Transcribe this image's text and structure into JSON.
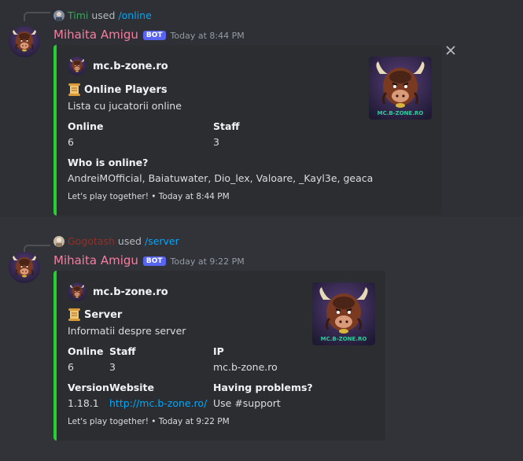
{
  "messages": [
    {
      "reply": {
        "user": "Timi",
        "user_color": "#3ba55c",
        "verb": "used",
        "command": "/online"
      },
      "author": {
        "name": "Mihaita Amigu",
        "badge": "BOT",
        "timestamp": "Today at 8:44 PM"
      },
      "embed": {
        "accent": "#23d132",
        "author_name": "mc.b-zone.ro",
        "title_emoji": "scroll-icon",
        "title": "Online Players",
        "description": "Lista cu jucatorii online",
        "fields": [
          {
            "name": "Online",
            "value": "6"
          },
          {
            "name": "Staff",
            "value": "3"
          },
          {
            "name": "Who is online?",
            "value": "AndreiMOfficial, Baiatuwater, Dio_lex, Valoare, _Kayl3e, geaca"
          }
        ],
        "footer": "Let's play together! • Today at 8:44 PM",
        "thumbnail_text": "MC.B-ZONE.RO"
      }
    },
    {
      "reply": {
        "user": "Gogotash",
        "user_color": "#992d22",
        "verb": "used",
        "command": "/server"
      },
      "author": {
        "name": "Mihaita Amigu",
        "badge": "BOT",
        "timestamp": "Today at 9:22 PM"
      },
      "embed": {
        "accent": "#23d132",
        "author_name": "mc.b-zone.ro",
        "title_emoji": "scroll-icon",
        "title": "Server",
        "description": "Informatii despre server",
        "fields": [
          {
            "name": "Online",
            "value": "6"
          },
          {
            "name": "Staff",
            "value": "3"
          },
          {
            "name": "IP",
            "value": "mc.b-zone.ro"
          },
          {
            "name": "Version",
            "value": "1.18.1"
          },
          {
            "name": "Website",
            "value": "http://mc.b-zone.ro/"
          },
          {
            "name": "Having problems?",
            "value": "Use #support"
          }
        ],
        "footer": "Let's play together! • Today at 9:22 PM",
        "thumbnail_text": "MC.B-ZONE.RO"
      }
    }
  ],
  "icons": {
    "dismiss": "close-icon"
  }
}
